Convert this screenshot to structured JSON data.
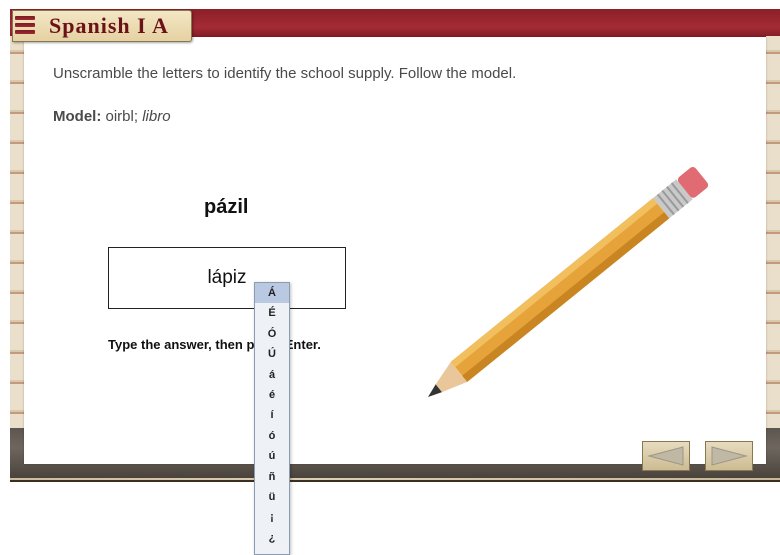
{
  "header": {
    "app_title": "Spanish I A",
    "menu_icon": "hamburger-menu-icon"
  },
  "exercise": {
    "instruction": "Unscramble the letters to identify the school supply. Follow the model.",
    "model_label": "Model:",
    "model_scrambled": "oirbl;",
    "model_answer": "libro",
    "scrambled_word": "pázil",
    "answer_value": "lápiz",
    "hint": "Type the answer, then press Enter."
  },
  "accent_popup": {
    "items": [
      "Á",
      "É",
      "Ó",
      "Ú",
      "á",
      "é",
      "í",
      "ó",
      "ú",
      "ñ",
      "ü",
      "¡",
      "¿"
    ],
    "selected": "Á"
  },
  "illustration": {
    "name": "pencil-illustration",
    "colors": {
      "body": "#e6a33a",
      "eraser": "#e06b72",
      "ferrule": "#c9c9c9",
      "wood": "#e9c79a",
      "lead": "#333333"
    }
  },
  "navigation": {
    "prev_icon": "arrow-left-icon",
    "next_icon": "arrow-right-icon"
  },
  "colors": {
    "banner_red": "#8b1f28",
    "title_red": "#6b1118",
    "tab_tan": "#e5d2a3"
  }
}
